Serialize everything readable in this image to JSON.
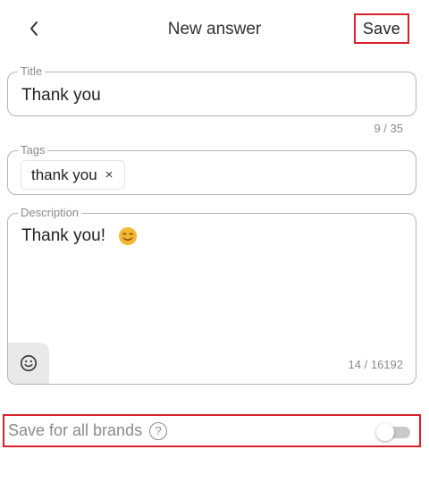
{
  "header": {
    "back_icon": "chevron-left-icon",
    "title": "New answer",
    "save_label": "Save"
  },
  "title_field": {
    "label": "Title",
    "value": "Thank you",
    "counter": "9 / 35"
  },
  "tags_field": {
    "label": "Tags",
    "tags": [
      {
        "label": "thank you",
        "remove_glyph": "×"
      }
    ]
  },
  "description_field": {
    "label": "Description",
    "value": "Thank you!",
    "emoji": "smiling-face-emoji",
    "emoji_button_icon": "smiley-icon",
    "counter": "14 / 16192"
  },
  "brands": {
    "label": "Save for all brands",
    "help_glyph": "?",
    "toggle_on": false
  },
  "colors": {
    "highlight": "#d9222a",
    "border": "#b5b5b5",
    "muted_text": "#8a8a8a",
    "emoji_yellow": "#f5b731"
  }
}
